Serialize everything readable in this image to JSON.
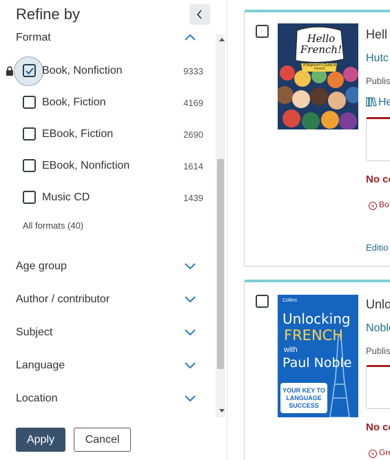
{
  "panel": {
    "title": "Refine by",
    "collapse_icon": "chevron-left-icon",
    "format": {
      "label": "Format",
      "expanded": true,
      "options": [
        {
          "label": "Book, Nonfiction",
          "count": "9333",
          "checked": true
        },
        {
          "label": "Book, Fiction",
          "count": "4169",
          "checked": false
        },
        {
          "label": "EBook, Fiction",
          "count": "2690",
          "checked": false
        },
        {
          "label": "EBook, Nonfiction",
          "count": "1614",
          "checked": false
        },
        {
          "label": "Music CD",
          "count": "1439",
          "checked": false
        }
      ],
      "all_link": "All formats (40)"
    },
    "sections": [
      {
        "label": "Age group"
      },
      {
        "label": "Author / contributor"
      },
      {
        "label": "Subject"
      },
      {
        "label": "Language"
      },
      {
        "label": "Location"
      }
    ],
    "apply_label": "Apply",
    "cancel_label": "Cancel"
  },
  "results": [
    {
      "title": "Hell",
      "author": "Hutc",
      "pub": "Publis",
      "format": "He",
      "status": "No co",
      "note": "Bo",
      "edition": "Editio",
      "cover": {
        "title_line1": "Hello",
        "title_line2": "French!",
        "subtitle": "A Beginner's Guide to French",
        "bg": "#1d3b66"
      }
    },
    {
      "title": "Unlo",
      "author": "Noble",
      "pub": "Publis",
      "status": "No co",
      "note": "Gre",
      "cover": {
        "brand": "Collins",
        "line1": "Unlocking",
        "line2": "FRENCH",
        "line3": "with",
        "line4": "Paul Noble",
        "tagline1": "YOUR KEY TO",
        "tagline2": "LANGUAGE",
        "tagline3": "SUCCESS",
        "bg": "#1565c0"
      }
    }
  ],
  "colors": {
    "accent": "#38526e",
    "link": "#1f6f8b",
    "unavailable": "#a51d24",
    "card_top": "#7fcfd4"
  }
}
